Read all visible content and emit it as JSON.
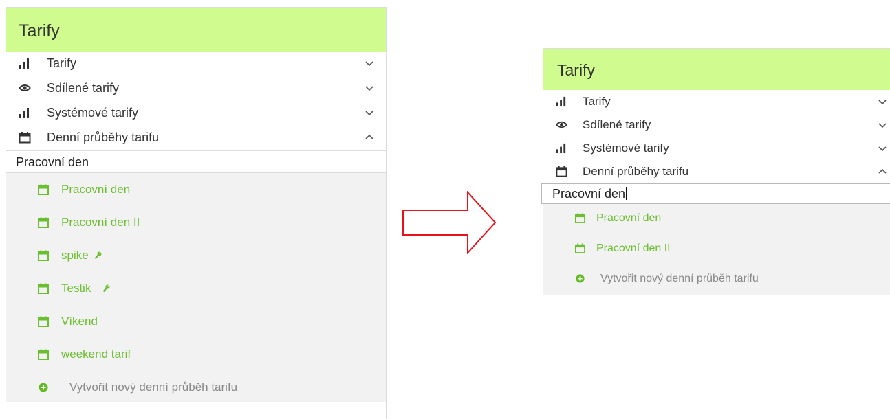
{
  "colors": {
    "header_bg": "#d0fb8f",
    "item_green": "#6abf2e",
    "create_icon_green": "#5fbb1f",
    "arrow_red": "#e8141b"
  },
  "panels": [
    {
      "title": "Tarify",
      "nav": [
        {
          "label": "Tarify",
          "icon": "bar-chart-icon",
          "chevron": "chevron-down-icon"
        },
        {
          "label": "Sdílené tarify",
          "icon": "eye-icon",
          "chevron": "chevron-down-icon"
        },
        {
          "label": "Systémové tarify",
          "icon": "bar-chart-icon",
          "chevron": "chevron-down-icon"
        },
        {
          "label": "Denní průběhy tarifu",
          "icon": "calendar-icon",
          "chevron": "chevron-up-icon"
        }
      ],
      "search_value": "Pracovní den",
      "items": [
        {
          "label": "Pracovní den",
          "icon": "calendar-icon"
        },
        {
          "label": "Pracovní den II",
          "icon": "calendar-icon"
        },
        {
          "label": "spike",
          "icon": "calendar-icon",
          "badge": "wrench-icon"
        },
        {
          "label": "Testik",
          "icon": "calendar-icon",
          "badge": "wrench-icon"
        },
        {
          "label": "Víkend",
          "icon": "calendar-icon"
        },
        {
          "label": "weekend tarif",
          "icon": "calendar-icon"
        }
      ],
      "create_label": "Vytvořit nový denní průběh tarifu"
    },
    {
      "title": "Tarify",
      "nav": [
        {
          "label": "Tarify",
          "icon": "bar-chart-icon",
          "chevron": "chevron-down-icon"
        },
        {
          "label": "Sdílené tarify",
          "icon": "eye-icon",
          "chevron": "chevron-down-icon"
        },
        {
          "label": "Systémové tarify",
          "icon": "bar-chart-icon",
          "chevron": "chevron-down-icon"
        },
        {
          "label": "Denní průběhy tarifu",
          "icon": "calendar-icon",
          "chevron": "chevron-up-icon"
        }
      ],
      "search_value": "Pracovní den",
      "items": [
        {
          "label": "Pracovní den",
          "icon": "calendar-icon"
        },
        {
          "label": "Pracovní den II",
          "icon": "calendar-icon"
        }
      ],
      "create_label": "Vytvořit nový denní průběh tarifu"
    }
  ],
  "arrow": {
    "icon": "arrow-right-icon"
  }
}
